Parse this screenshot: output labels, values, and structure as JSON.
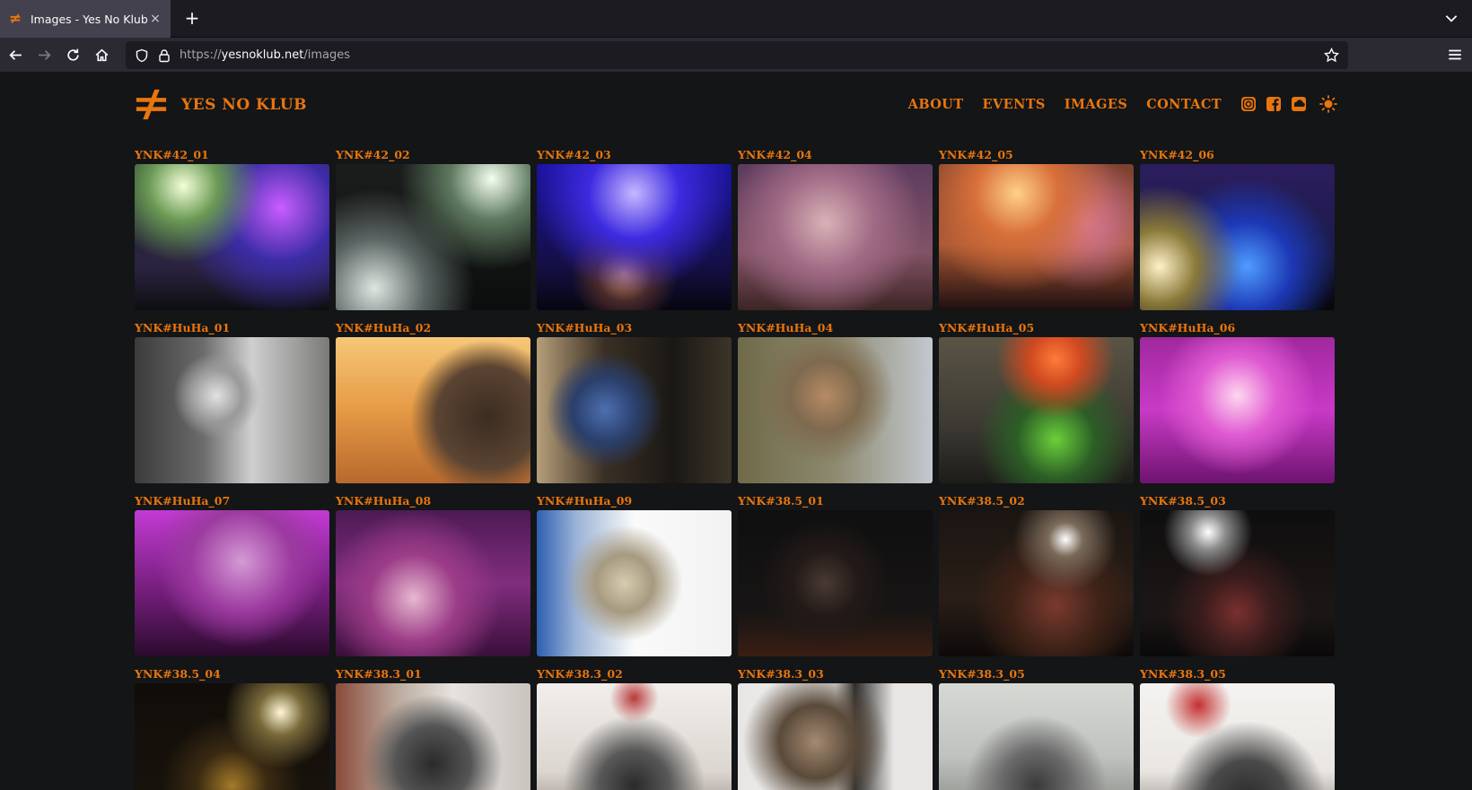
{
  "browser": {
    "tab_title": "Images - Yes No Klub",
    "new_tab_label": "+",
    "tab_close_label": "×",
    "url_scheme": "https://",
    "url_host": "yesnoklub.net",
    "url_path": "/images"
  },
  "site": {
    "title": "YES NO KLUB",
    "accent_color": "#e8750e",
    "nav": {
      "about": "ABOUT",
      "events": "EVENTS",
      "images": "IMAGES",
      "contact": "CONTACT"
    },
    "social_icons": [
      "instagram-icon",
      "facebook-icon",
      "soundcloud-icon"
    ],
    "theme_icon": "sun-icon"
  },
  "gallery": {
    "captions": [
      "YNK#42_01",
      "YNK#42_02",
      "YNK#42_03",
      "YNK#42_04",
      "YNK#42_05",
      "YNK#42_06",
      "YNK#HuHa_01",
      "YNK#HuHa_02",
      "YNK#HuHa_03",
      "YNK#HuHa_04",
      "YNK#HuHa_05",
      "YNK#HuHa_06",
      "YNK#HuHa_07",
      "YNK#HuHa_08",
      "YNK#HuHa_09",
      "YNK#38.5_01",
      "YNK#38.5_02",
      "YNK#38.5_03",
      "YNK#38.5_04",
      "YNK#38.3_01",
      "YNK#38.3_02",
      "YNK#38.3_03",
      "YNK#38.3_05",
      "YNK#38.3_05"
    ]
  }
}
